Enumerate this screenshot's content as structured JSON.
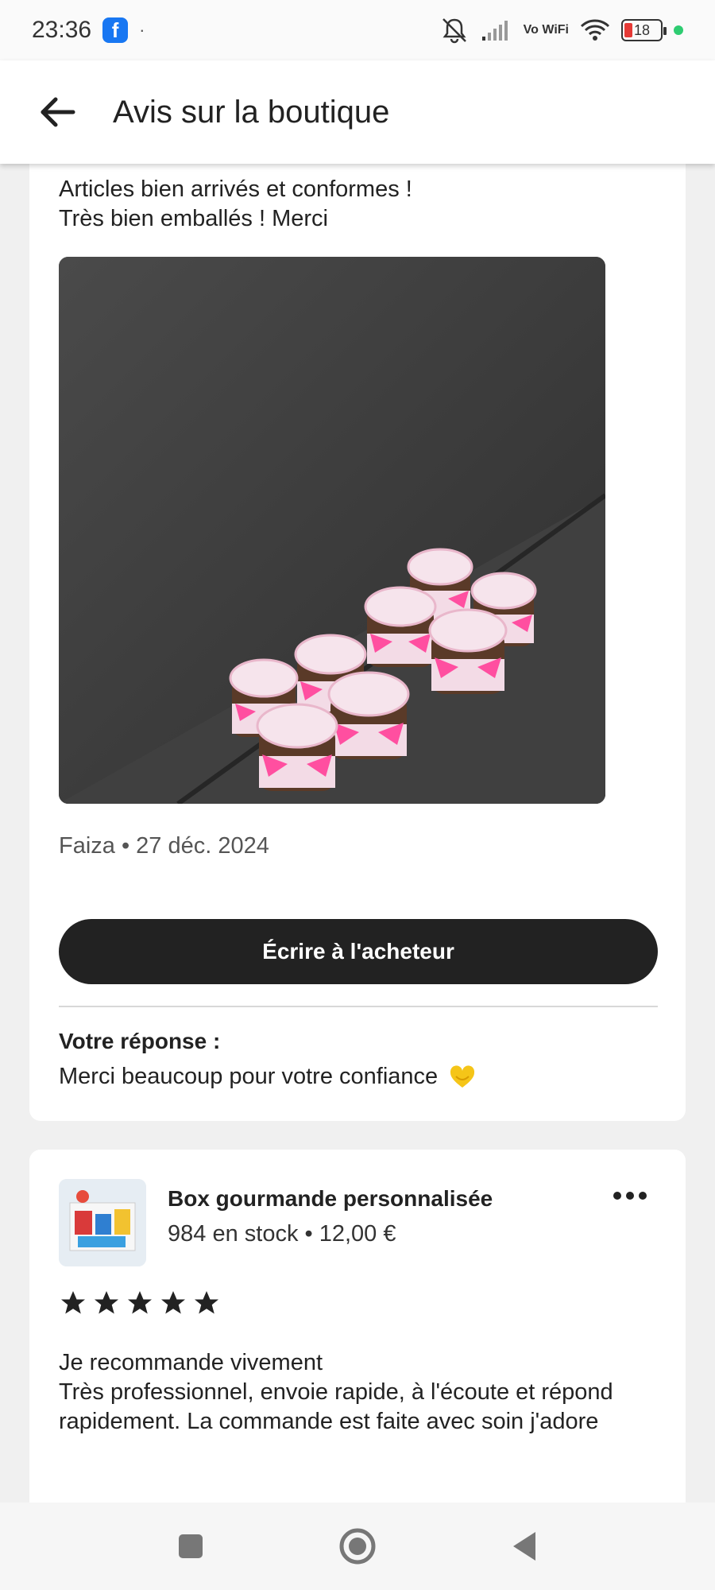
{
  "status_bar": {
    "time": "23:36",
    "app_icon": "facebook-icon",
    "dot": "·",
    "vowifi": "Vo WiFi",
    "battery_level": "18",
    "indicator_color": "#2ecc71"
  },
  "header": {
    "back_icon": "arrow-left-icon",
    "title": "Avis sur la boutique"
  },
  "review1": {
    "text": "Articles bien arrivés et conformes !\nTrès bien emballés ! Merci",
    "photo_description": "nutella-jars-photo",
    "meta": "Faiza • 27 déc. 2024",
    "write_button": "Écrire à l'acheteur",
    "reply_label": "Votre réponse :",
    "reply_text": "Merci beaucoup pour votre confiance"
  },
  "review2": {
    "product_title": "Box gourmande personnalisée",
    "product_sub": "984 en stock • 12,00 €",
    "rating": 5,
    "text": "Je recommande vivement\nTrès professionnel, envoie rapide, à l'écoute et répond rapidement. La commande est faite avec soin j'adore"
  },
  "colors": {
    "accent_dark": "#222222",
    "heart": "#f5c518"
  }
}
